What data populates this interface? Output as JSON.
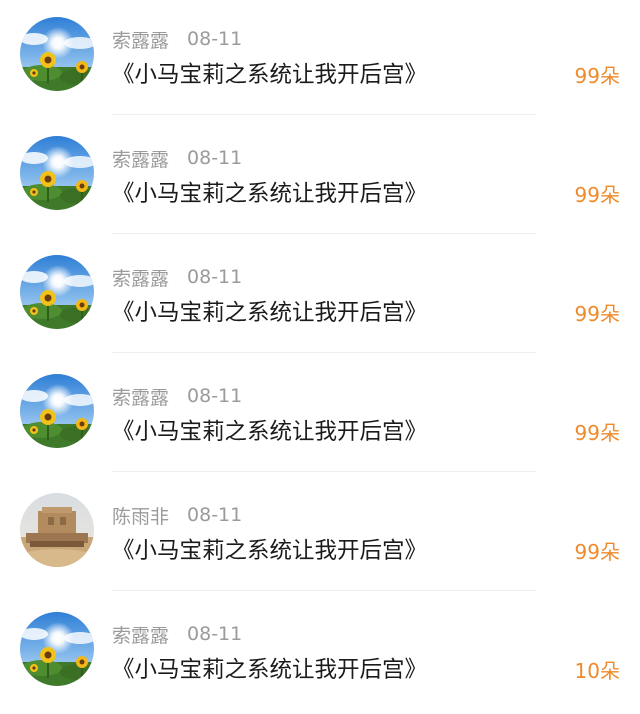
{
  "rows": [
    {
      "name": "索露露",
      "date": "08-11",
      "title": "《小马宝莉之系统让我开后宫》",
      "count": "99朵",
      "avatar": "sunflower-avatar"
    },
    {
      "name": "索露露",
      "date": "08-11",
      "title": "《小马宝莉之系统让我开后宫》",
      "count": "99朵",
      "avatar": "sunflower-avatar"
    },
    {
      "name": "索露露",
      "date": "08-11",
      "title": "《小马宝莉之系统让我开后宫》",
      "count": "99朵",
      "avatar": "sunflower-avatar"
    },
    {
      "name": "索露露",
      "date": "08-11",
      "title": "《小马宝莉之系统让我开后宫》",
      "count": "99朵",
      "avatar": "sunflower-avatar"
    },
    {
      "name": "陈雨非",
      "date": "08-11",
      "title": "《小马宝莉之系统让我开后宫》",
      "count": "99朵",
      "avatar": "ruins-avatar"
    },
    {
      "name": "索露露",
      "date": "08-11",
      "title": "《小马宝莉之系统让我开后宫》",
      "count": "10朵",
      "avatar": "sunflower-avatar"
    }
  ],
  "colors": {
    "accent": "#ef8a2b",
    "username": "#9b9b9b",
    "title": "#1b1b1b",
    "divider": "#efefef"
  }
}
